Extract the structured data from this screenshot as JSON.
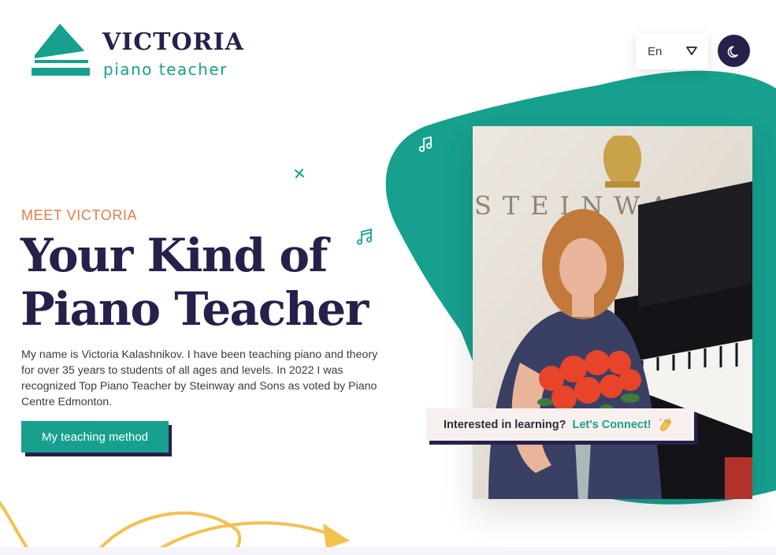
{
  "brand": {
    "name": "VICTORIA",
    "subtitle": "piano teacher"
  },
  "header": {
    "language": "En",
    "language_caret_icon": "triangle-down-icon",
    "theme_icon": "moon-icon"
  },
  "hero": {
    "eyebrow": "MEET VICTORIA",
    "title_line1": "Your Kind of",
    "title_line2": "Piano Teacher",
    "intro": "My name is Victoria Kalashnikov. I have been teaching piano and theory for over 35 years to students of all ages and levels. In 2022 I was recognized Top Piano Teacher by Steinway and Sons as voted by Piano Centre Edmonton.",
    "cta": "My teaching method"
  },
  "photo": {
    "wall_text": "STEINWAY & SO"
  },
  "connect": {
    "question": "Interested in learning?",
    "link": "Let's Connect!",
    "icon": "waving-hand-icon"
  },
  "colors": {
    "teal": "#17a08e",
    "navy": "#25214a",
    "orange": "#e47b49",
    "yellow": "#f2c14e"
  }
}
